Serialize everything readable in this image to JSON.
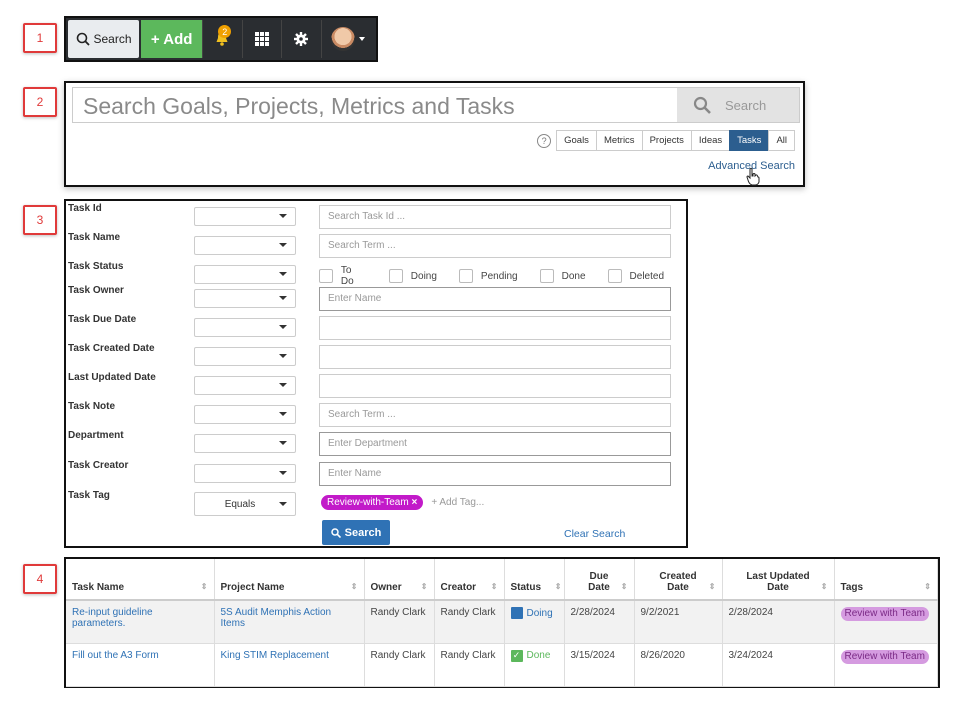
{
  "steps": [
    "1",
    "2",
    "3",
    "4"
  ],
  "topbar": {
    "search_label": "Search",
    "add_label": "+ Add",
    "notification_count": "2"
  },
  "search": {
    "placeholder": "Search Goals, Projects, Metrics and Tasks",
    "button_label": "Search",
    "filters": [
      "Goals",
      "Metrics",
      "Projects",
      "Ideas",
      "Tasks",
      "All"
    ],
    "active_filter": "Tasks",
    "help": "?",
    "advanced_link": "Advanced Search"
  },
  "form": {
    "rows": [
      {
        "label": "Task Id",
        "op": "",
        "placeholder": "Search Task Id ..."
      },
      {
        "label": "Task Name",
        "op": "",
        "placeholder": "Search Term ..."
      },
      {
        "label": "Task Status",
        "op": ""
      },
      {
        "label": "Task Owner",
        "op": "",
        "placeholder": "Enter Name"
      },
      {
        "label": "Task Due Date",
        "op": "",
        "placeholder": ""
      },
      {
        "label": "Task Created Date",
        "op": "",
        "placeholder": ""
      },
      {
        "label": "Last Updated Date",
        "op": "",
        "placeholder": ""
      },
      {
        "label": "Task Note",
        "op": "",
        "placeholder": "Search Term ..."
      },
      {
        "label": "Department",
        "op": "",
        "placeholder": "Enter Department"
      },
      {
        "label": "Task Creator",
        "op": "",
        "placeholder": "Enter Name"
      },
      {
        "label": "Task Tag",
        "op": "Equals"
      }
    ],
    "status_options": [
      "To Do",
      "Doing",
      "Pending",
      "Done",
      "Deleted"
    ],
    "selected_tag": "Review-with-Team",
    "add_tag": "+ Add Tag...",
    "search_button": "Search",
    "clear_link": "Clear Search"
  },
  "results": {
    "columns": [
      "Task Name",
      "Project Name",
      "Owner",
      "Creator",
      "Status",
      "Due Date",
      "Created Date",
      "Last Updated Date",
      "Tags"
    ],
    "rows": [
      {
        "task": "Re-input guideline parameters.",
        "project": "5S Audit Memphis Action Items",
        "owner": "Randy Clark",
        "creator": "Randy Clark",
        "status": "Doing",
        "due": "2/28/2024",
        "created": "9/2/2021",
        "updated": "2/28/2024",
        "tag": "Review with Team"
      },
      {
        "task": "Fill out the A3 Form",
        "project": "King STIM Replacement",
        "owner": "Randy Clark",
        "creator": "Randy Clark",
        "status": "Done",
        "due": "3/15/2024",
        "created": "8/26/2020",
        "updated": "3/24/2024",
        "tag": "Review with Team"
      }
    ],
    "status_colors": {
      "Doing": "#2f72b5",
      "Done": "#5cb85c"
    }
  }
}
